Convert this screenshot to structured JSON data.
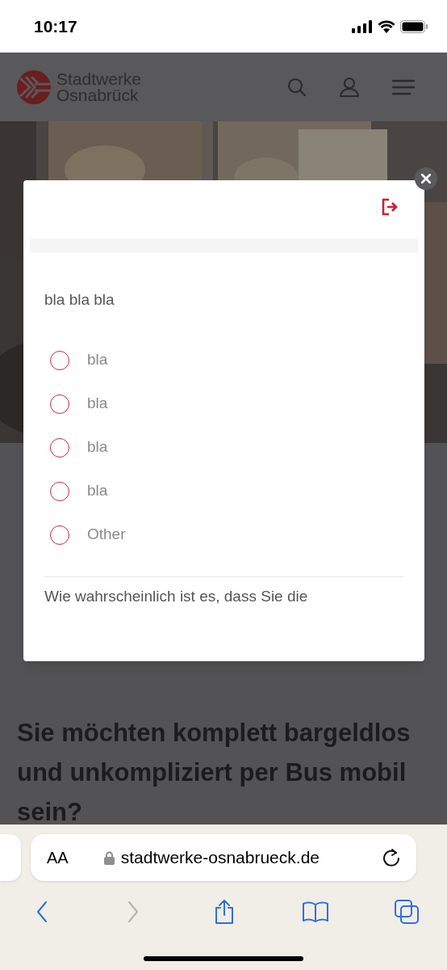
{
  "status_bar": {
    "time": "10:17"
  },
  "site_header": {
    "logo_line1": "Stadtwerke",
    "logo_line2": "Osnabrück"
  },
  "page": {
    "lead": "Sie möchten komplett bargeldlos und unkompliziert per Bus mobil sein?"
  },
  "survey_modal": {
    "question": "bla bla bla",
    "options": [
      {
        "label": "bla",
        "selected": false
      },
      {
        "label": "bla",
        "selected": false
      },
      {
        "label": "bla",
        "selected": false
      },
      {
        "label": "bla",
        "selected": false
      },
      {
        "label": "Other",
        "selected": false
      }
    ],
    "next_question": "Wie wahrscheinlich ist es, dass Sie die"
  },
  "browser": {
    "text_size_button": "AA",
    "url": "stadtwerke-osnabrueck.de",
    "toolbar": [
      {
        "kind": "back",
        "disabled": false
      },
      {
        "kind": "forward",
        "disabled": true
      },
      {
        "kind": "share",
        "disabled": false
      },
      {
        "kind": "bookmarks",
        "disabled": false
      },
      {
        "kind": "tabs",
        "disabled": false
      }
    ]
  }
}
